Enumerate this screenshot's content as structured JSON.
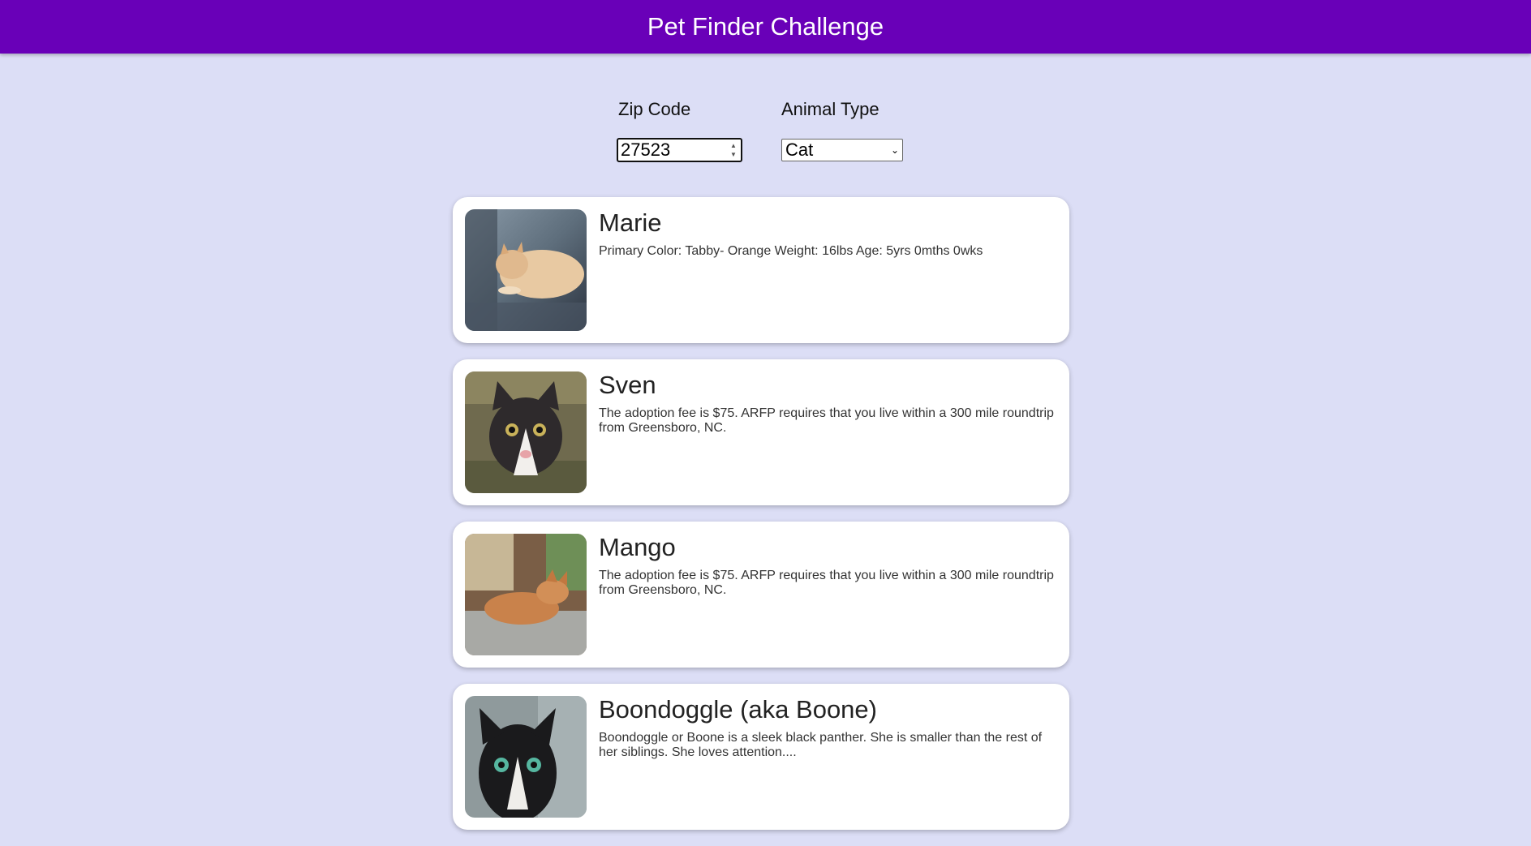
{
  "header": {
    "title": "Pet Finder Challenge"
  },
  "filters": {
    "zip_label": "Zip Code",
    "zip_value": "27523",
    "type_label": "Animal Type",
    "type_selected": "Cat"
  },
  "pets": [
    {
      "name": "Marie",
      "description": "Primary Color: Tabby- Orange Weight: 16lbs Age: 5yrs 0mths 0wks",
      "photo_icon": "orange-tabby-cat-photo"
    },
    {
      "name": "Sven",
      "description": "The adoption fee is $75. ARFP requires that you live within a 300 mile roundtrip from Greensboro, NC.",
      "photo_icon": "gray-white-kitten-photo"
    },
    {
      "name": "Mango",
      "description": "The adoption fee is $75. ARFP requires that you live within a 300 mile roundtrip from Greensboro, NC.",
      "photo_icon": "sleeping-orange-kitten-photo"
    },
    {
      "name": "Boondoggle (aka Boone)",
      "description": "Boondoggle or Boone is a sleek black panther. She is smaller than the rest of her siblings. She loves attention....",
      "photo_icon": "black-cat-photo"
    }
  ],
  "colors": {
    "header_bg": "#6900b8",
    "page_bg": "#dcdef6",
    "card_bg": "#ffffff"
  }
}
